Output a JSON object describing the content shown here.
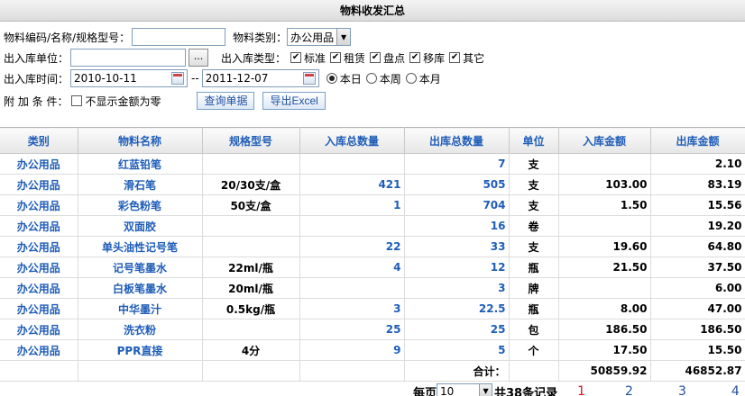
{
  "header": {
    "title": "物料收发汇总"
  },
  "filters": {
    "material_label": "物料编码/名称/规格型号：",
    "material_value": "",
    "category_label": "物料类别：",
    "category_value": "办公用品",
    "unit_label": "出入库单位：",
    "unit_value": "",
    "unit_btn": "...",
    "type_label": "出入库类型：",
    "types": [
      "标准",
      "租赁",
      "盘点",
      "移库",
      "其它"
    ],
    "time_label": "出入库时间：",
    "date_from": "2010-10-11",
    "date_sep": "--",
    "date_to": "2011-12-07",
    "periods": [
      "本日",
      "本周",
      "本月"
    ],
    "extra_label": "附 加 条 件：",
    "hide_zero_label": "不显示金额为零",
    "query_btn": "查询单据",
    "export_btn": "导出Excel"
  },
  "table": {
    "columns": [
      "类别",
      "物料名称",
      "规格型号",
      "入库总数量",
      "出库总数量",
      "单位",
      "入库金额",
      "出库金额"
    ],
    "rows": [
      [
        "办公用品",
        "红蓝铅笔",
        "",
        "",
        "7",
        "支",
        "",
        "2.10"
      ],
      [
        "办公用品",
        "滑石笔",
        "20/30支/盒",
        "421",
        "505",
        "支",
        "103.00",
        "83.19"
      ],
      [
        "办公用品",
        "彩色粉笔",
        "50支/盒",
        "1",
        "704",
        "支",
        "1.50",
        "15.56"
      ],
      [
        "办公用品",
        "双面胶",
        "",
        "",
        "16",
        "卷",
        "",
        "19.20"
      ],
      [
        "办公用品",
        "单头油性记号笔",
        "",
        "22",
        "33",
        "支",
        "19.60",
        "64.80"
      ],
      [
        "办公用品",
        "记号笔墨水",
        "22ml/瓶",
        "4",
        "12",
        "瓶",
        "21.50",
        "37.50"
      ],
      [
        "办公用品",
        "白板笔墨水",
        "20ml/瓶",
        "",
        "3",
        "牌",
        "",
        "6.00"
      ],
      [
        "办公用品",
        "中华墨汁",
        "0.5kg/瓶",
        "3",
        "22.5",
        "瓶",
        "8.00",
        "47.00"
      ],
      [
        "办公用品",
        "洗衣粉",
        "",
        "25",
        "25",
        "包",
        "186.50",
        "186.50"
      ],
      [
        "办公用品",
        "PPR直接",
        "4分",
        "9",
        "5",
        "个",
        "17.50",
        "15.50"
      ]
    ],
    "total_label": "合计：",
    "total_in_amount": "50859.92",
    "total_out_amount": "46852.87"
  },
  "pager": {
    "per_page_label": "每页",
    "per_page_value": "10",
    "total_text": "共38条记录",
    "pages": [
      "1",
      "2",
      "3",
      "4"
    ]
  }
}
